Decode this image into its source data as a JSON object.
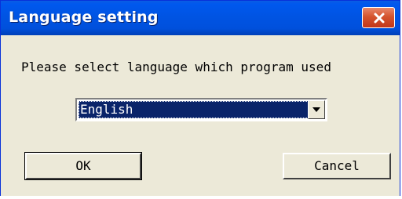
{
  "window": {
    "title": "Language setting",
    "close_icon": "close-icon",
    "colors": {
      "titlebar": "#0054E3",
      "close": "#D5542E",
      "body": "#ECE9D8",
      "selection": "#0A246A"
    }
  },
  "dialog": {
    "prompt": "Please select language which program used",
    "language_select": {
      "selected": "English",
      "arrow_icon": "chevron-down-icon"
    },
    "ok_label": "OK",
    "cancel_label": "Cancel"
  }
}
